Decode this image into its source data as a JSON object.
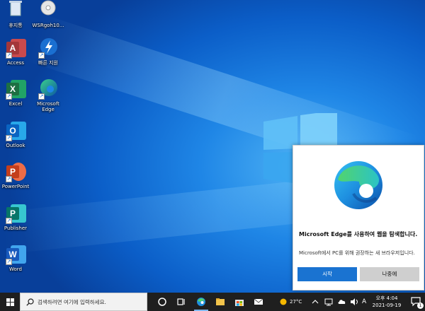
{
  "desktop": {
    "icons": [
      {
        "label": "휴지통",
        "icon": "recycle-bin-icon"
      },
      {
        "label": "WSRgoh10...",
        "icon": "cd-disc-icon"
      },
      {
        "label": "Access",
        "icon": "access-icon",
        "color": "#a4373a",
        "letter": "A"
      },
      {
        "label": "빠른 지원",
        "icon": "quick-assist-icon"
      },
      {
        "label": "Excel",
        "icon": "excel-icon",
        "color": "#1d6f42",
        "letter": "X"
      },
      {
        "label": "Microsoft Edge",
        "icon": "edge-icon"
      },
      {
        "label": "Outlook",
        "icon": "outlook-icon",
        "color": "#0a64c2",
        "letter": "O"
      },
      {
        "label": "PowerPoint",
        "icon": "powerpoint-icon",
        "color": "#c43e1c",
        "letter": "P"
      },
      {
        "label": "Publisher",
        "icon": "publisher-icon",
        "color": "#077568",
        "letter": "P"
      },
      {
        "label": "Word",
        "icon": "word-icon",
        "color": "#185abd",
        "letter": "W"
      }
    ]
  },
  "toast": {
    "title": "Microsoft Edge를 사용하여 웹을 탐색합니다.",
    "description": "Microsoft에서 PC를 위해 권장하는 새 브라우저입니다.",
    "start_label": "시작",
    "later_label": "나중에",
    "accent": "#1a73d1"
  },
  "taskbar": {
    "search_placeholder": "검색하려면 여기에 입력하세요.",
    "weather": "27°C",
    "ime": "A",
    "clock_time": "오후 4:04",
    "clock_date": "2021-09-19",
    "notification_count": "1"
  }
}
